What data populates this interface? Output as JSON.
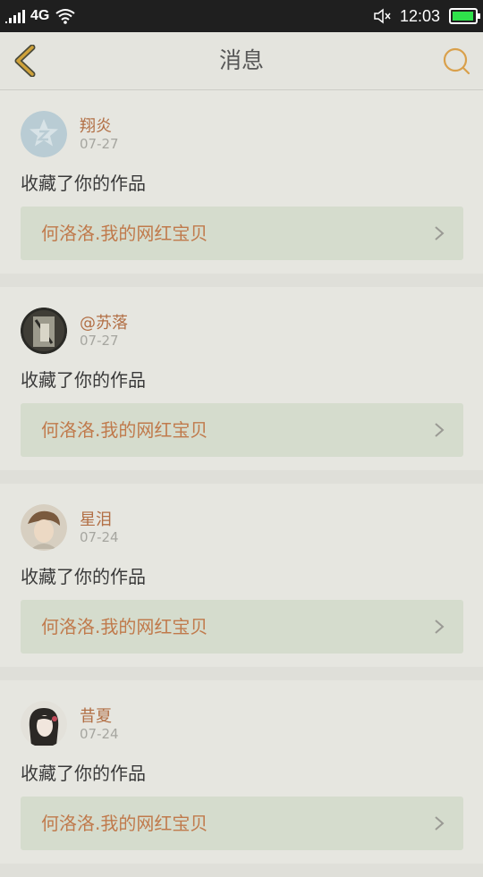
{
  "status_bar": {
    "network": "4G",
    "time": "12:03",
    "battery_color": "#2fe24b"
  },
  "header": {
    "title": "消息",
    "back_icon": "chevron-left-icon",
    "search_icon": "search-icon",
    "accent": "#d9a04b"
  },
  "messages": [
    {
      "user": "翔炎",
      "date": "07-27",
      "action": "收藏了你的作品",
      "work": "何洛洛.我的网红宝贝",
      "avatar": "default-avatar"
    },
    {
      "user": "@苏落",
      "date": "07-27",
      "action": "收藏了你的作品",
      "work": "何洛洛.我的网红宝贝",
      "avatar": "photo-avatar"
    },
    {
      "user": "星泪",
      "date": "07-24",
      "action": "收藏了你的作品",
      "work": "何洛洛.我的网红宝贝",
      "avatar": "photo-avatar"
    },
    {
      "user": "昔夏",
      "date": "07-24",
      "action": "收藏了你的作品",
      "work": "何洛洛.我的网红宝贝",
      "avatar": "photo-avatar"
    }
  ]
}
